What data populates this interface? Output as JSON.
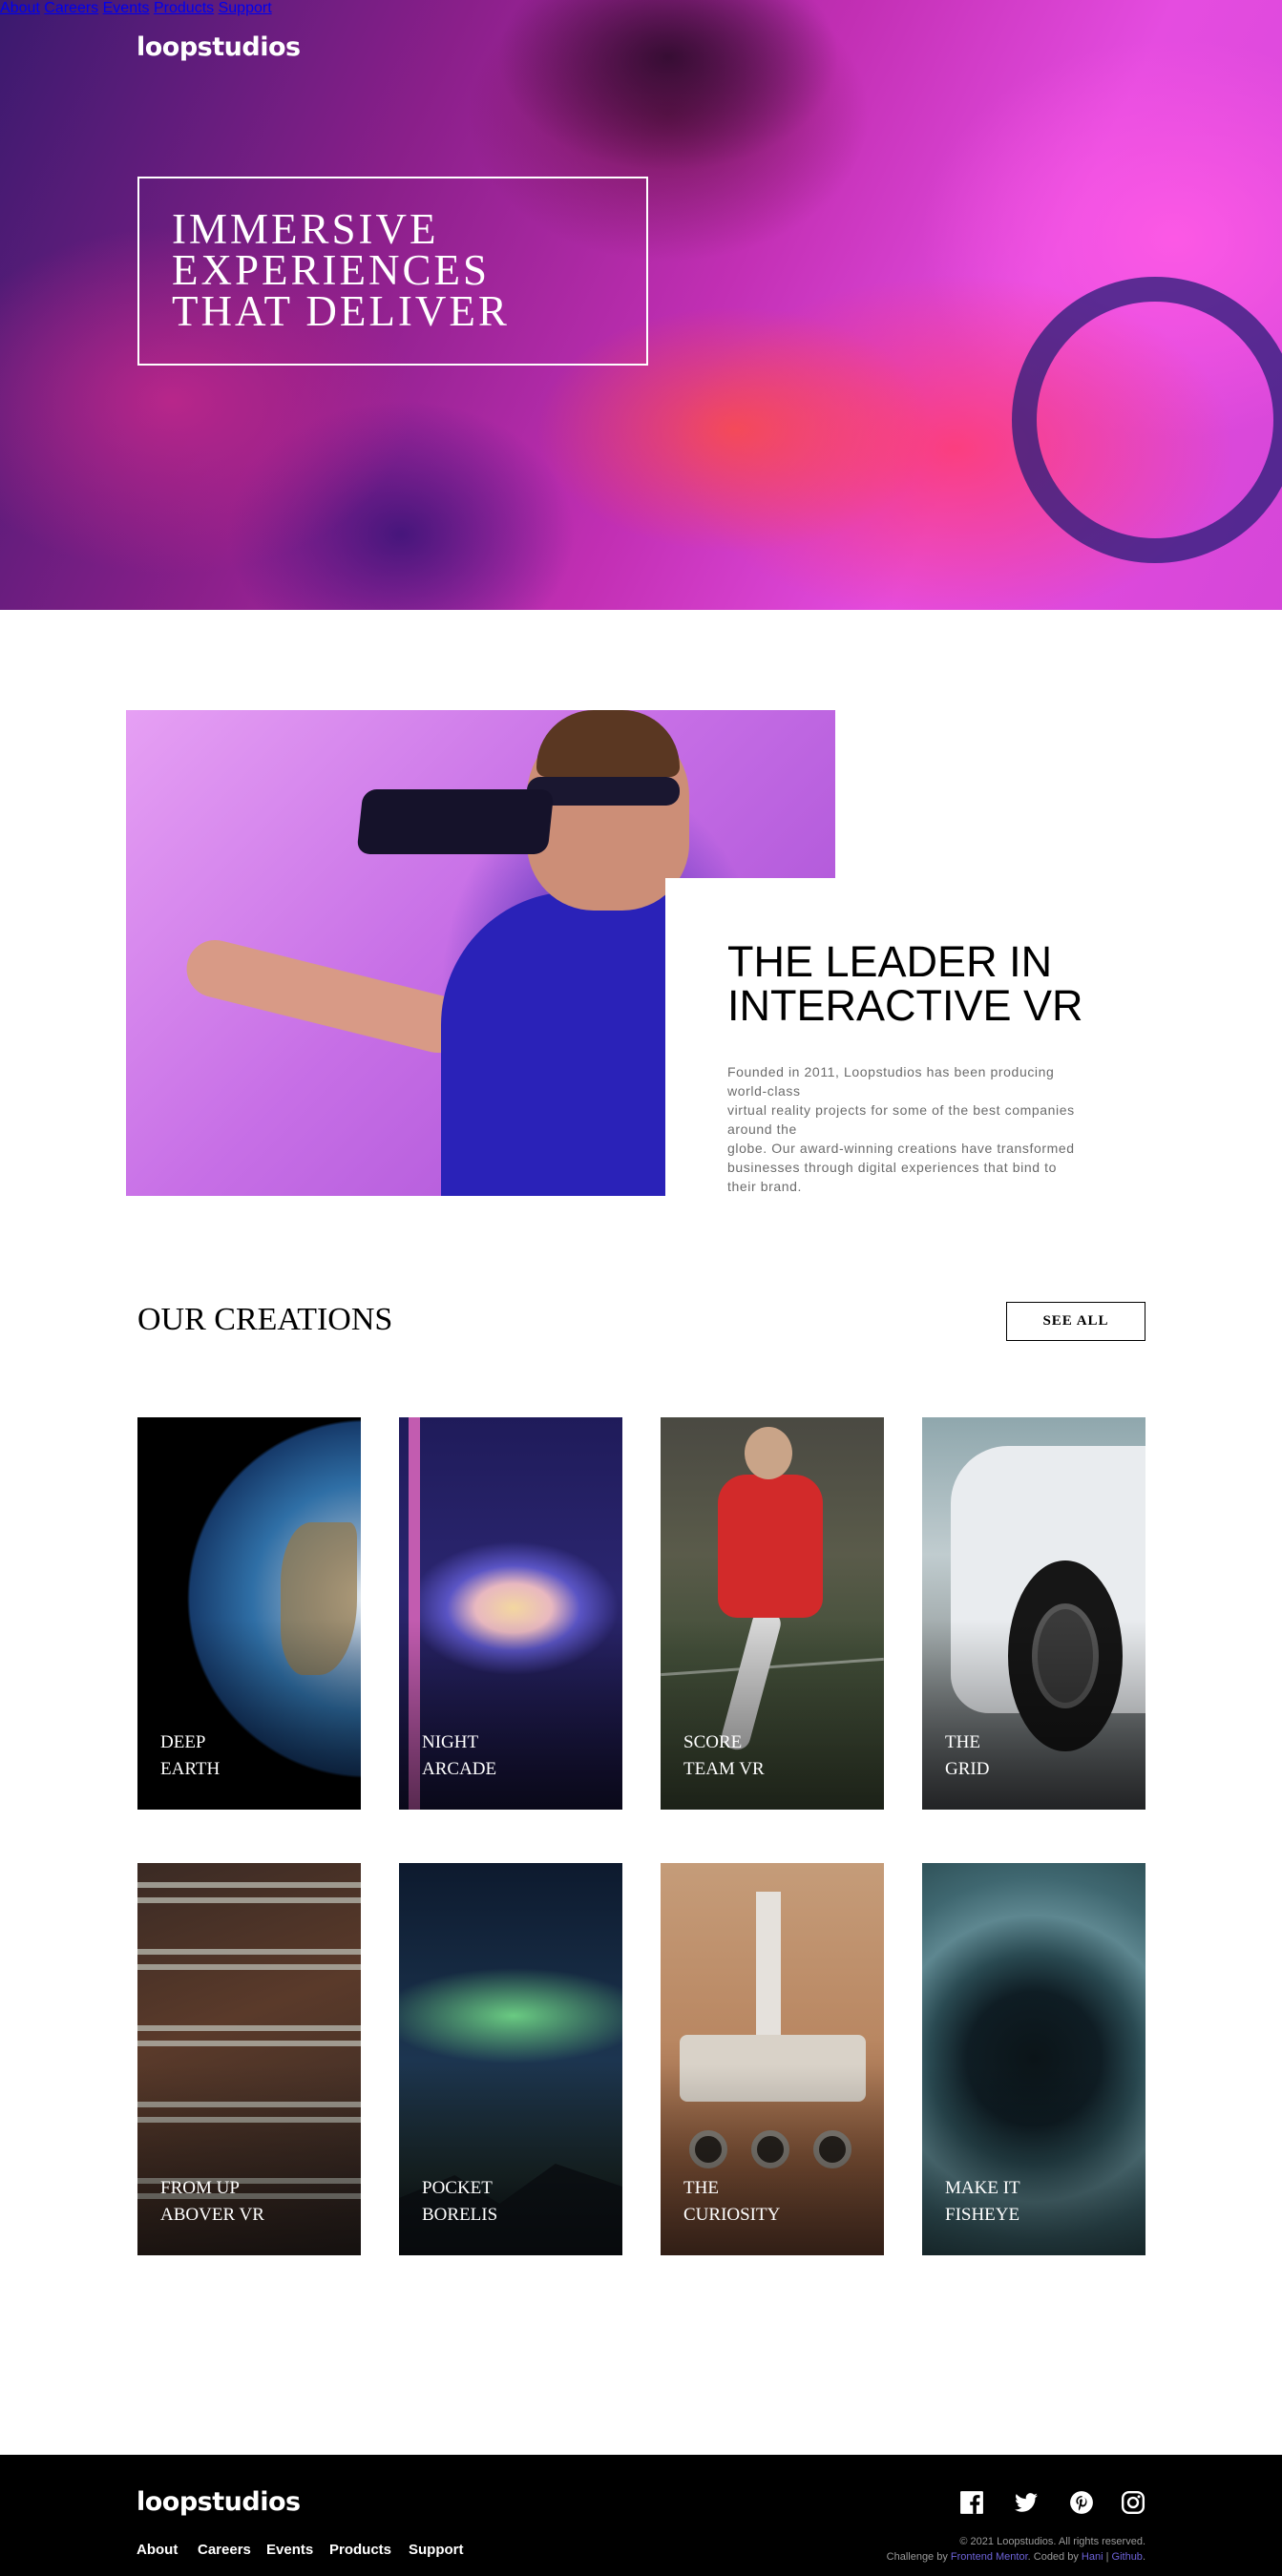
{
  "header": {
    "logo": "loopstudios",
    "nav": [
      "About",
      "Careers",
      "Events",
      "Products",
      "Support"
    ]
  },
  "hero": {
    "title_lines": [
      "IMMERSIVE",
      "EXPERIENCES",
      "THAT DELIVER"
    ]
  },
  "about": {
    "title_lines": [
      "THE LEADER IN",
      "INTERACTIVE VR"
    ],
    "text_lines": [
      "Founded in 2011, Loopstudios has been producing",
      "world-class",
      "virtual reality projects for some of the best companies",
      "around the",
      "globe. Our award-winning creations have transformed",
      "businesses through digital experiences that bind to",
      "their brand."
    ]
  },
  "creations": {
    "title": "OUR CREATIONS",
    "see_all": "SEE ALL",
    "items": [
      {
        "line1": "DEEP",
        "line2": "EARTH"
      },
      {
        "line1": "NIGHT",
        "line2": "ARCADE"
      },
      {
        "line1": "SCORE",
        "line2": "TEAM VR"
      },
      {
        "line1": "THE",
        "line2": "GRID"
      },
      {
        "line1": "FROM UP",
        "line2": "ABOVER VR"
      },
      {
        "line1": "POCKET",
        "line2": "BORELIS"
      },
      {
        "line1": "THE",
        "line2": "CURIOSITY"
      },
      {
        "line1": "MAKE IT",
        "line2": "FISHEYE"
      }
    ]
  },
  "footer": {
    "logo": "loopstudios",
    "nav": [
      "About",
      "Careers",
      "Events",
      "Products",
      "Support"
    ],
    "social_icons": [
      "facebook-icon",
      "twitter-icon",
      "pinterest-icon",
      "instagram-icon"
    ],
    "copyright": "© 2021 Loopstudios. All rights reserved.",
    "challenge_prefix": "Challenge by ",
    "challenge_link": "Frontend Mentor",
    "coded_prefix": ". Coded by ",
    "coded_link_1": "Hani",
    "coded_sep": " | ",
    "coded_link_2": "Github",
    "coded_suffix": "."
  }
}
